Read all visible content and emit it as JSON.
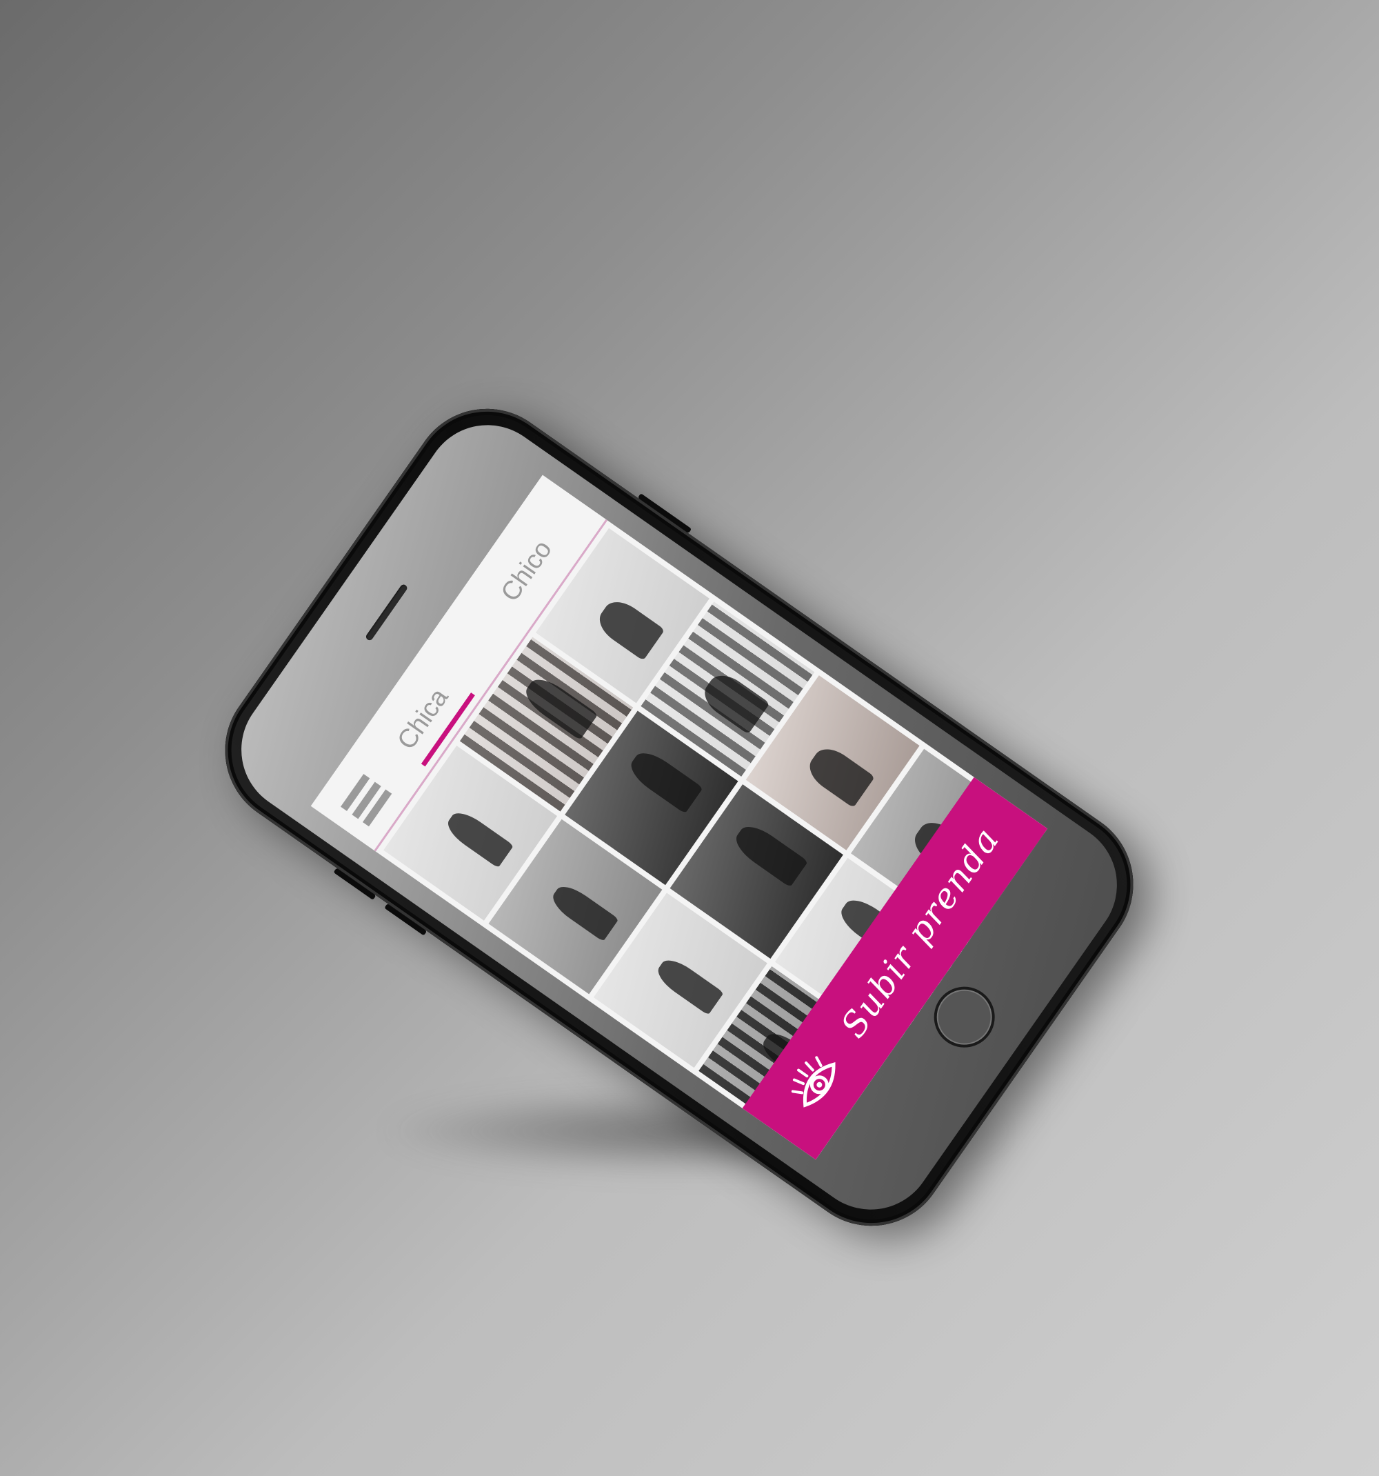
{
  "app": {
    "tabs": [
      {
        "label": "Chica",
        "active": true
      },
      {
        "label": "Chico",
        "active": false
      }
    ],
    "menu_icon": "hamburger-menu-icon",
    "upload": {
      "label": "Subir prenda",
      "icon": "eye-icon"
    },
    "gallery": {
      "items": [
        "light",
        "warm",
        "light",
        "mid",
        "dark",
        "light",
        "light",
        "dark",
        "warm",
        "dark",
        "light",
        "mid",
        "mid",
        "light",
        "dark"
      ]
    }
  },
  "colors": {
    "accent": "#c8107e",
    "header_divider": "#d9a9c8",
    "tab_text": "#9a9a9a",
    "screen_bg": "#f4f4f4"
  }
}
